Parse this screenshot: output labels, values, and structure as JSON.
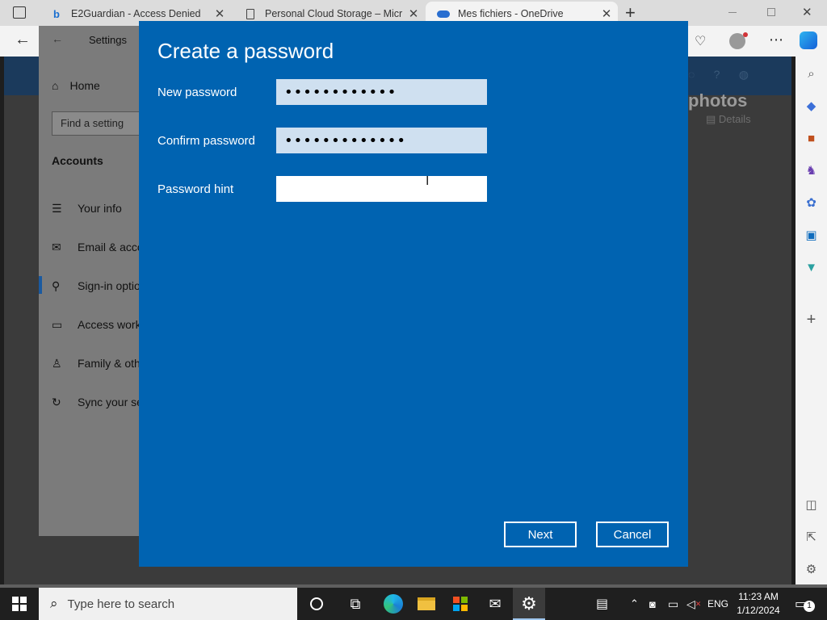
{
  "browser": {
    "tabs": [
      {
        "title": "E2Guardian - Access Denied",
        "icon": "bing-icon"
      },
      {
        "title": "Personal Cloud Storage – Micros",
        "icon": "page-icon"
      },
      {
        "title": "Mes fichiers - OneDrive",
        "icon": "onedrive-icon"
      }
    ],
    "close_glyph": "✕",
    "new_tab_glyph": "+"
  },
  "page": {
    "heading_fragment": "photos",
    "details_label": "Details"
  },
  "settings": {
    "window_title": "Settings",
    "home": "Home",
    "search_placeholder": "Find a setting",
    "section": "Accounts",
    "items": [
      {
        "label": "Your info",
        "icon": "person-card-icon"
      },
      {
        "label": "Email & acco",
        "icon": "mail-icon"
      },
      {
        "label": "Sign-in optio",
        "icon": "key-icon"
      },
      {
        "label": "Access work",
        "icon": "briefcase-icon"
      },
      {
        "label": "Family & oth",
        "icon": "person-add-icon"
      },
      {
        "label": "Sync your se",
        "icon": "sync-icon"
      }
    ]
  },
  "dialog": {
    "title": "Create a password",
    "new_password_label": "New password",
    "new_password_value": "••••••••••••",
    "confirm_password_label": "Confirm password",
    "confirm_password_value": "•••••••••••••",
    "hint_label": "Password hint",
    "hint_value": "",
    "next_label": "Next",
    "cancel_label": "Cancel",
    "accent_color": "#0063b1"
  },
  "taskbar": {
    "search_placeholder": "Type here to search",
    "language": "ENG",
    "time": "11:23 AM",
    "date": "1/12/2024",
    "notification_count": "1"
  }
}
